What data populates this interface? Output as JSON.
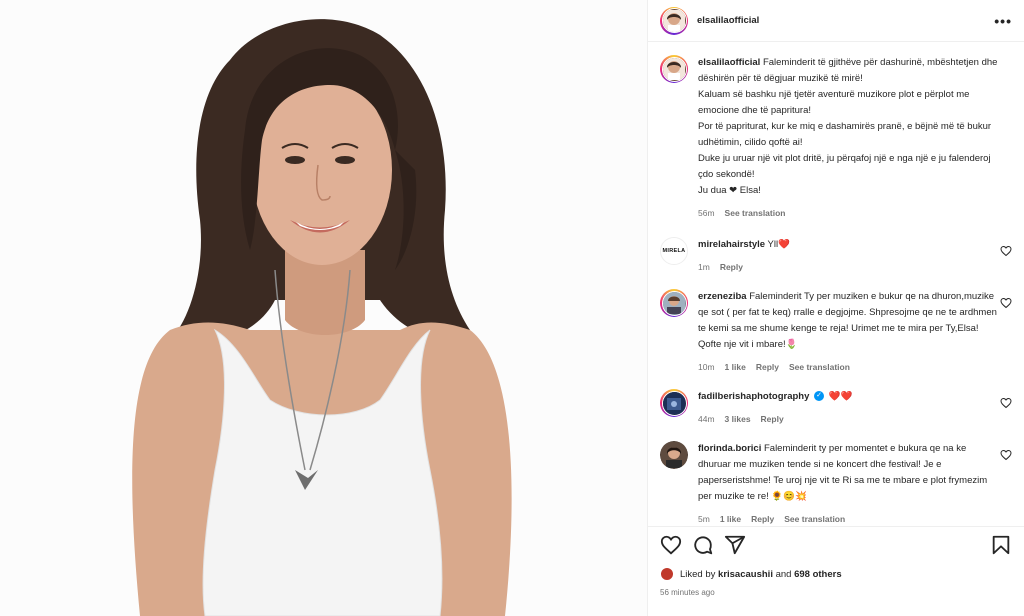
{
  "header": {
    "username": "elsalilaofficial",
    "more_icon": "more-horizontal-icon",
    "more_label": "•••"
  },
  "caption": {
    "username": "elsalilaofficial",
    "lines": [
      "Faleminderit të gjithëve për dashurinë, mbështetjen dhe dëshirën për të dëgjuar muzikë të mirë!",
      "Kaluam së bashku një tjetër aventurë muzikore plot e përplot me emocione dhe të papritura!",
      "Por të papriturat, kur ke miq e dashamirës pranë, e bëjnë më të bukur udhëtimin, cilido qoftë ai!",
      "Duke ju uruar një vit plot dritë, ju përqafoj një e nga një e ju falenderoj çdo sekondë!",
      "Ju dua ❤ Elsa!"
    ],
    "time": "56m",
    "see_translation": "See translation"
  },
  "comments": [
    {
      "username": "mirelahairstyle",
      "avatar_text": "MIRELA",
      "text": "Yll❤️",
      "time": "1m",
      "likes": "",
      "reply": "Reply",
      "see_translation": ""
    },
    {
      "username": "erzeneziba",
      "text": "Faleminderit Ty per muziken e bukur qe na dhuron,muzike qe sot ( per fat te keq) rralle e degjojme. Shpresojme qe ne te ardhmen te kemi sa me shume kenge te reja! Urimet me te mira per Ty,Elsa! Qofte nje vit i mbare!🌷",
      "time": "10m",
      "likes": "1 like",
      "reply": "Reply",
      "see_translation": "See translation"
    },
    {
      "username": "fadilberishaphotography",
      "text": "❤️❤️",
      "time": "44m",
      "likes": "3 likes",
      "reply": "Reply",
      "see_translation": ""
    },
    {
      "username": "florinda.borici",
      "text": "Faleminderit ty per momentet e bukura qe na ke dhuruar me muziken tende si ne koncert dhe festival! Je e paperseristshme! Te uroj nje vit te Ri sa me te mbare e plot frymezim per muzike te re! 🌻😊💥",
      "time": "5m",
      "likes": "1 like",
      "reply": "Reply",
      "see_translation": "See translation"
    }
  ],
  "actions": {
    "like_icon": "heart-icon",
    "comment_icon": "comment-icon",
    "share_icon": "share-icon",
    "save_icon": "bookmark-icon"
  },
  "likes": {
    "prefix": "Liked by ",
    "user": "krisacaushii",
    "middle": " and ",
    "count": "698 others"
  },
  "posted_ago": "56 minutes ago",
  "colors": {
    "verified": "#0095f6",
    "meta_gray": "#737373",
    "text": "#262626"
  }
}
